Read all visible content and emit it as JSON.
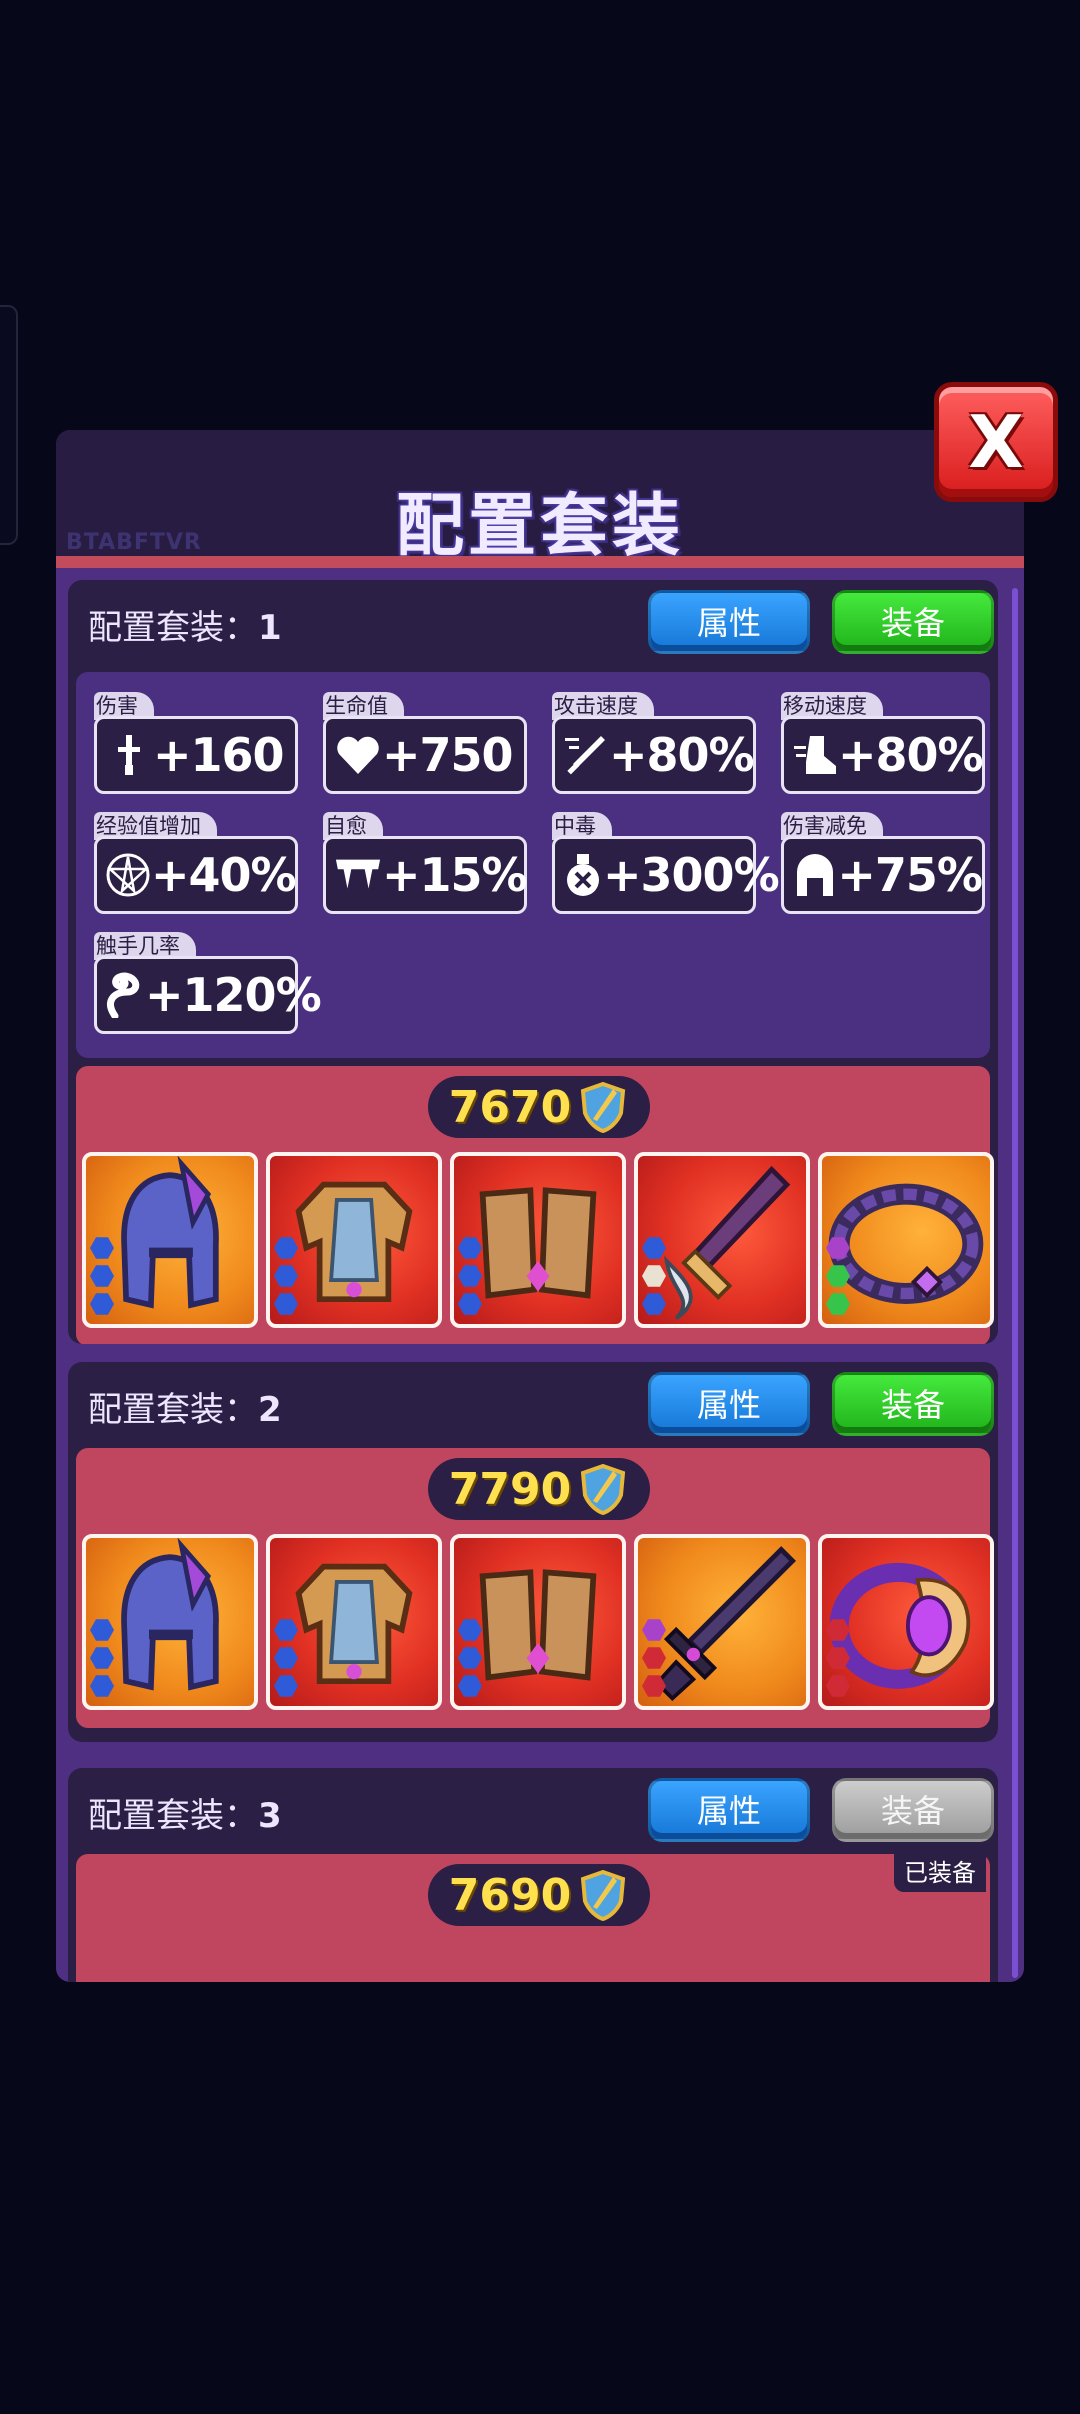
{
  "panel": {
    "title": "配置套装",
    "watermark": "BTABFTVR",
    "close_label": "X"
  },
  "colors": {
    "background": "#07071a",
    "panel": "#2f2350",
    "stats_bg": "#4b2f80",
    "gear_bg": "#c04660",
    "attr_button": "#2a8ef0",
    "equip_button": "#33cf2c",
    "equip_disabled": "#b4b4b4",
    "score_text": "#ffe04f"
  },
  "loadouts": [
    {
      "title": "配置套装：",
      "number": "1",
      "attr_button": "属性",
      "equip_button": "装备",
      "stats": [
        {
          "label": "伤害",
          "value": "+160",
          "icon": "sword-icon"
        },
        {
          "label": "生命值",
          "value": "+750",
          "icon": "heart-icon"
        },
        {
          "label": "攻击速度",
          "value": "+80%",
          "icon": "attack-speed-icon"
        },
        {
          "label": "移动速度",
          "value": "+80%",
          "icon": "boot-icon"
        },
        {
          "label": "经验值增加",
          "value": "+40%",
          "icon": "pentagram-icon"
        },
        {
          "label": "自愈",
          "value": "+15%",
          "icon": "fangs-icon"
        },
        {
          "label": "中毒",
          "value": "+300%",
          "icon": "poison-icon"
        },
        {
          "label": "伤害减免",
          "value": "+75%",
          "icon": "helmet-icon"
        },
        {
          "label": "触手几率",
          "value": "+120%",
          "icon": "tentacle-icon"
        }
      ],
      "power": "7670",
      "gear": [
        {
          "item": "helmet-icon",
          "rarity": "orange",
          "gems": [
            "blue",
            "blue",
            "blue"
          ]
        },
        {
          "item": "armor-icon",
          "rarity": "red",
          "gems": [
            "blue",
            "blue",
            "blue"
          ]
        },
        {
          "item": "gauntlets-icon",
          "rarity": "red",
          "gems": [
            "blue",
            "blue",
            "blue"
          ]
        },
        {
          "item": "blade-icon",
          "rarity": "red",
          "gems": [
            "blue",
            "white",
            "blue"
          ]
        },
        {
          "item": "belt-icon",
          "rarity": "orange",
          "gems": [
            "purple",
            "green",
            "green"
          ]
        }
      ]
    },
    {
      "title": "配置套装：",
      "number": "2",
      "attr_button": "属性",
      "equip_button": "装备",
      "power": "7790",
      "gear": [
        {
          "item": "helmet-icon",
          "rarity": "orange",
          "gems": [
            "blue",
            "blue",
            "blue"
          ]
        },
        {
          "item": "armor-icon",
          "rarity": "red",
          "gems": [
            "blue",
            "blue",
            "blue"
          ]
        },
        {
          "item": "gauntlets-icon",
          "rarity": "red",
          "gems": [
            "blue",
            "blue",
            "blue"
          ]
        },
        {
          "item": "sword-icon",
          "rarity": "orange",
          "gems": [
            "purple",
            "red",
            "red"
          ]
        },
        {
          "item": "ring-icon",
          "rarity": "red",
          "gems": [
            "red",
            "red",
            "red"
          ]
        }
      ]
    },
    {
      "title": "配置套装：",
      "number": "3",
      "attr_button": "属性",
      "equip_button": "装备",
      "equip_disabled": true,
      "equipped_tag": "已装备",
      "power": "7690"
    }
  ]
}
